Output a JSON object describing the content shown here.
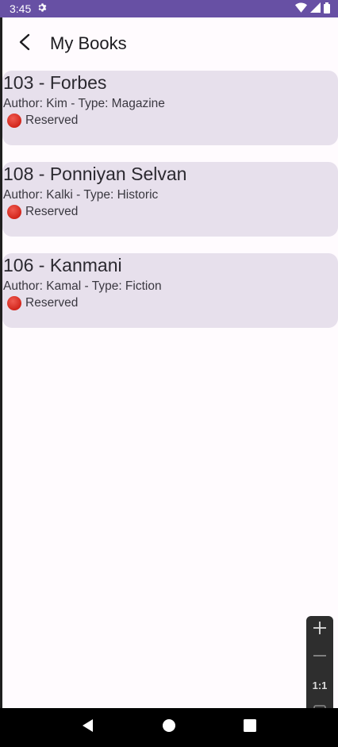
{
  "status_bar": {
    "time": "3:45",
    "icons": [
      "settings-gear-icon",
      "wifi-icon",
      "signal-icon",
      "battery-icon"
    ]
  },
  "app_bar": {
    "title": "My Books",
    "back_icon": "arrow-back-icon"
  },
  "books": [
    {
      "title": "103 - Forbes",
      "meta": "Author: Kim - Type: Magazine",
      "status": "Reserved"
    },
    {
      "title": "108 - Ponniyan Selvan",
      "meta": "Author: Kalki - Type: Historic",
      "status": "Reserved"
    },
    {
      "title": "106 - Kanmani",
      "meta": "Author: Kamal - Type: Fiction",
      "status": "Reserved"
    }
  ],
  "zoom_controls": {
    "one_to_one_label": "1:1"
  },
  "colors": {
    "status_bar": "#6750a4",
    "card_bg": "#e7e0ec",
    "page_bg": "#fffbfe",
    "reserved_dot": "#d2261c"
  }
}
